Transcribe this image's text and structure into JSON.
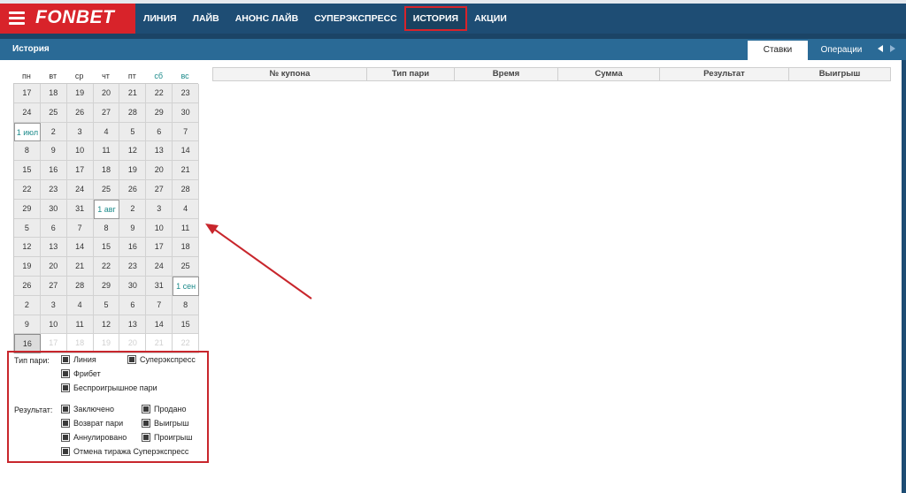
{
  "header": {
    "logo": "FONBET",
    "nav": [
      "ЛИНИЯ",
      "ЛАЙВ",
      "АНОНС ЛАЙВ",
      "СУПЕРЭКСПРЕСС",
      "ИСТОРИЯ",
      "АКЦИИ"
    ],
    "active_nav": "ИСТОРИЯ"
  },
  "titlebar": {
    "title": "История",
    "tabs": [
      "Ставки",
      "Операции"
    ],
    "active_tab": "Ставки"
  },
  "calendar": {
    "weekdays": [
      "пн",
      "вт",
      "ср",
      "чт",
      "пт",
      "сб",
      "вс"
    ],
    "rows": [
      [
        "17",
        "18",
        "19",
        "20",
        "21",
        "22",
        "23"
      ],
      [
        "24",
        "25",
        "26",
        "27",
        "28",
        "29",
        "30"
      ],
      [
        "1 июл",
        "2",
        "3",
        "4",
        "5",
        "6",
        "7"
      ],
      [
        "8",
        "9",
        "10",
        "11",
        "12",
        "13",
        "14"
      ],
      [
        "15",
        "16",
        "17",
        "18",
        "19",
        "20",
        "21"
      ],
      [
        "22",
        "23",
        "24",
        "25",
        "26",
        "27",
        "28"
      ],
      [
        "29",
        "30",
        "31",
        "1 авг",
        "2",
        "3",
        "4"
      ],
      [
        "5",
        "6",
        "7",
        "8",
        "9",
        "10",
        "11"
      ],
      [
        "12",
        "13",
        "14",
        "15",
        "16",
        "17",
        "18"
      ],
      [
        "19",
        "20",
        "21",
        "22",
        "23",
        "24",
        "25"
      ],
      [
        "26",
        "27",
        "28",
        "29",
        "30",
        "31",
        "1 сен"
      ],
      [
        "2",
        "3",
        "4",
        "5",
        "6",
        "7",
        "8"
      ],
      [
        "9",
        "10",
        "11",
        "12",
        "13",
        "14",
        "15"
      ],
      [
        "16",
        "17",
        "18",
        "19",
        "20",
        "21",
        "22"
      ]
    ],
    "today": "16"
  },
  "filters": {
    "bet_type_label": "Тип пари:",
    "bet_types": {
      "line": "Линия",
      "superexpress": "Суперэкспресс",
      "freebet": "Фрибет",
      "no_lose": "Беспроигрышное пари"
    },
    "result_label": "Результат:",
    "results": {
      "concluded": "Заключено",
      "sold": "Продано",
      "refund": "Возврат пари",
      "win": "Выигрыш",
      "cancelled": "Аннулировано",
      "loss": "Проигрыш",
      "draw_cancel": "Отмена тиража Суперэкспресс"
    }
  },
  "table": {
    "columns": [
      "№ купона",
      "Тип пари",
      "Время",
      "Сумма",
      "Результат",
      "Выигрыш"
    ]
  },
  "colors": {
    "header_bg": "#1e4d74",
    "logo_bg": "#d8232a",
    "titlebar_bg": "#2a6a96",
    "highlight": "#d8232a"
  }
}
